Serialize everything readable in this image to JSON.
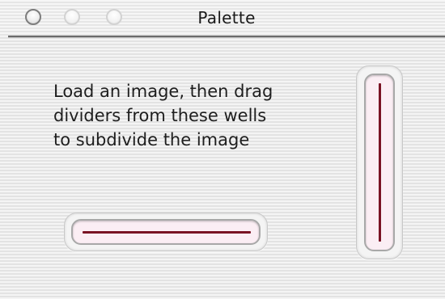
{
  "window": {
    "title": "Palette",
    "controls": {
      "close": "close-button",
      "minimize": "minimize-button",
      "zoom": "zoom-button"
    }
  },
  "content": {
    "instructions": [
      "Load an image, then drag",
      "dividers from these wells",
      "to subdivide the image"
    ],
    "wells": {
      "horizontal": "horizontal-divider-well",
      "vertical": "vertical-divider-well"
    }
  },
  "colors": {
    "divider": "#7a1324",
    "well_fill": "#fbeef4",
    "title_rule": "#6b6b6b"
  }
}
